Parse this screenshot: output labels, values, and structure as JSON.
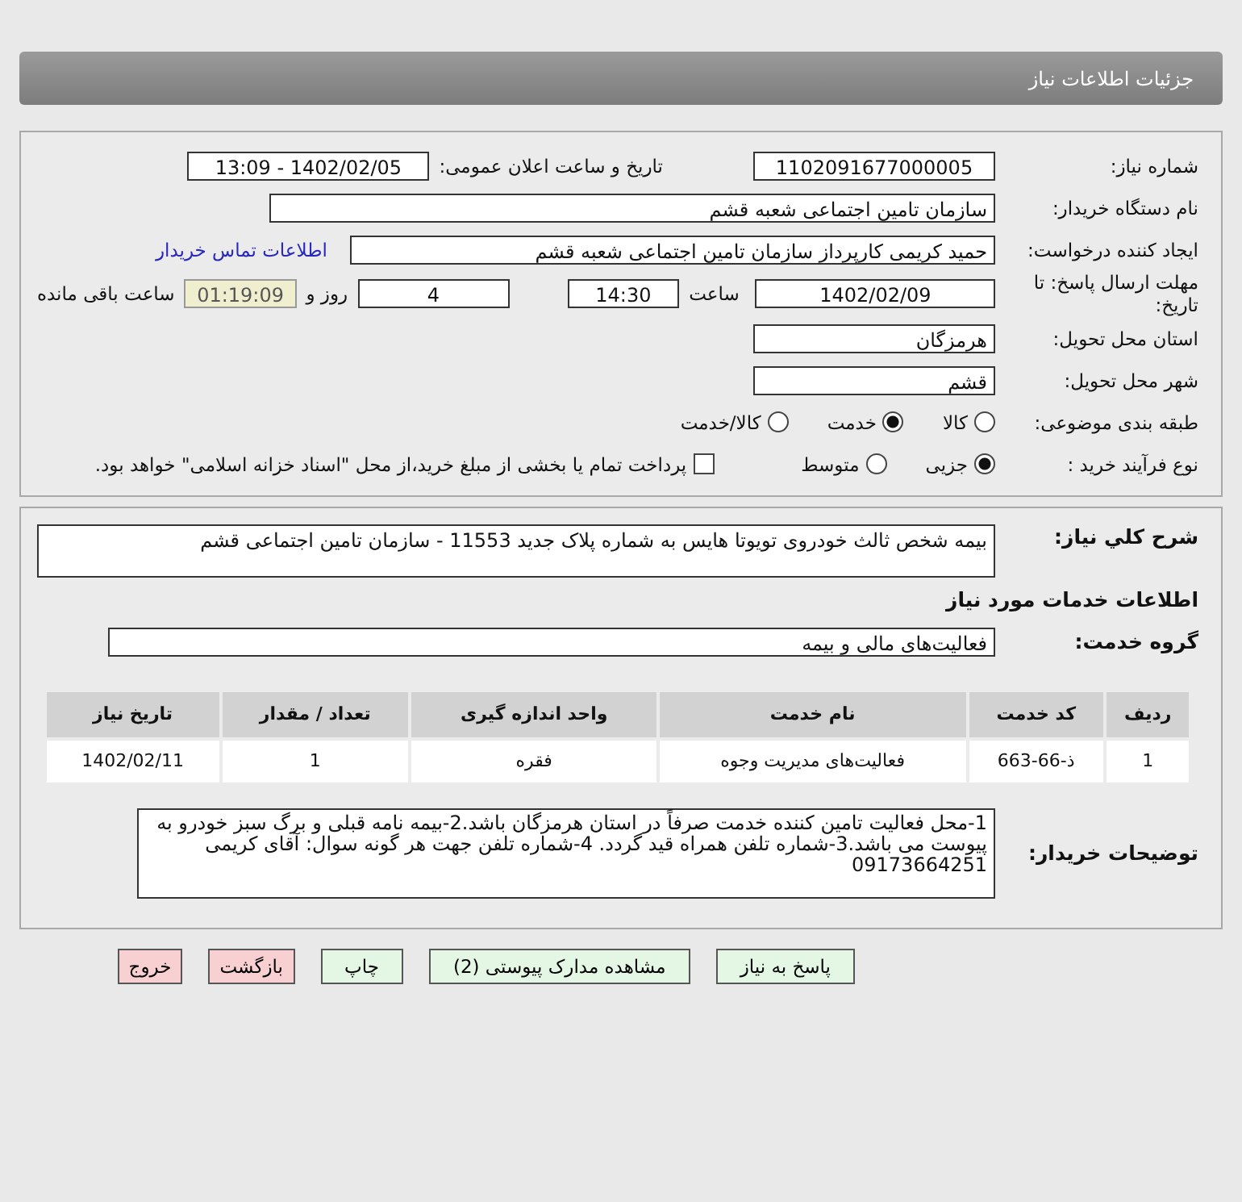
{
  "header": {
    "title": "جزئیات اطلاعات نیاز"
  },
  "details": {
    "need_number": {
      "label": "شماره نیاز:",
      "value": "1102091677000005"
    },
    "announce": {
      "label": "تاریخ و ساعت اعلان عمومی:",
      "value": "1402/02/05 - 13:09"
    },
    "buyer": {
      "label": "نام دستگاه خریدار:",
      "value": "سازمان تامین اجتماعی شعبه قشم"
    },
    "creator": {
      "label": "ایجاد کننده درخواست:",
      "value": "حمید کریمی کارپرداز سازمان تامین اجتماعی شعبه قشم",
      "link": "اطلاعات تماس خریدار"
    },
    "deadline": {
      "label": "مهلت ارسال پاسخ: تا تاریخ:",
      "date": "1402/02/09",
      "time_label": "ساعت",
      "time": "14:30",
      "days": "4",
      "days_label": "روز و",
      "remaining": "01:19:09",
      "remaining_label": "ساعت باقی مانده"
    },
    "province": {
      "label": "استان محل تحویل:",
      "value": "هرمزگان"
    },
    "city": {
      "label": "شهر محل تحویل:",
      "value": "قشم"
    },
    "category": {
      "label": "طبقه بندی موضوعی:",
      "options": [
        {
          "label": "کالا",
          "selected": false
        },
        {
          "label": "خدمت",
          "selected": true
        },
        {
          "label": "کالا/خدمت",
          "selected": false
        }
      ]
    },
    "process": {
      "label": "نوع فرآیند خرید :",
      "options": [
        {
          "label": "جزیی",
          "selected": true
        },
        {
          "label": "متوسط",
          "selected": false
        }
      ],
      "payment": {
        "label": "پرداخت تمام یا بخشی از مبلغ خرید،از محل \"اسناد خزانه اسلامی\" خواهد بود.",
        "checked": false
      }
    }
  },
  "summary": {
    "label": "شرح کلي نياز:",
    "value": "بیمه شخص ثالث خودروی تویوتا هایس به شماره پلاک جدید 11553 - سازمان تامین اجتماعی قشم"
  },
  "services_title": "اطلاعات خدمات مورد نیاز",
  "service_group": {
    "label": "گروه خدمت:",
    "value": "فعالیت‌های مالی و بیمه"
  },
  "table": {
    "columns": [
      "ردیف",
      "کد خدمت",
      "نام خدمت",
      "واحد اندازه گیری",
      "تعداد / مقدار",
      "تاریخ نیاز"
    ],
    "rows": [
      [
        "1",
        "ذ-66-663",
        "فعالیت‌های مدیریت وجوه",
        "فقره",
        "1",
        "1402/02/11"
      ]
    ]
  },
  "buyer_notes": {
    "label": "توضیحات خریدار:",
    "value": "1-محل فعالیت تامین کننده خدمت صرفاً در استان هرمزگان باشد.2-بیمه نامه قبلی و برگ سبز خودرو به پیوست می باشد.3-شماره تلفن همراه قید گردد. 4-شماره تلفن جهت هر گونه سوال: آقای کریمی 09173664251"
  },
  "buttons": [
    {
      "label": "پاسخ به نیاز",
      "kind": "primary"
    },
    {
      "label": "مشاهده مدارک پیوستی (2)",
      "kind": "primary"
    },
    {
      "label": "چاپ",
      "kind": "primary"
    },
    {
      "label": "بازگشت",
      "kind": "danger"
    },
    {
      "label": "خروج",
      "kind": "danger"
    }
  ]
}
